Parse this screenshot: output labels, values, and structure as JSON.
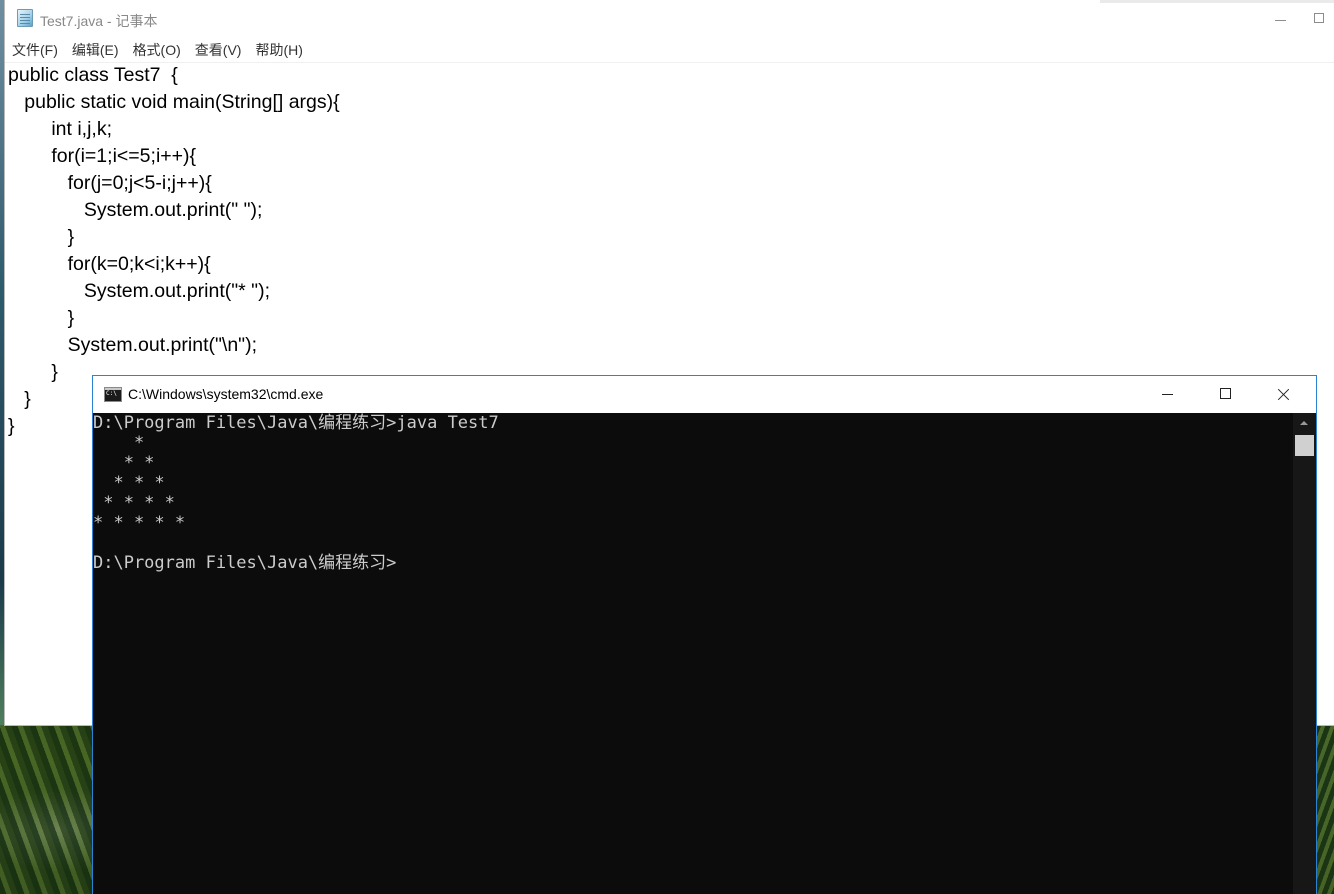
{
  "notepad": {
    "title": "Test7.java - 记事本",
    "menu": [
      "文件(F)",
      "编辑(E)",
      "格式(O)",
      "查看(V)",
      "帮助(H)"
    ],
    "code_lines": [
      "public class Test7  {",
      "   public static void main(String[] args){",
      "        int i,j,k;",
      "        for(i=1;i<=5;i++){",
      "           for(j=0;j<5-i;j++){",
      "              System.out.print(\" \");",
      "           }",
      "           for(k=0;k<i;k++){",
      "              System.out.print(\"* \");",
      "           }",
      "           System.out.print(\"\\n\");",
      "        }",
      "   }",
      "}"
    ]
  },
  "cmd": {
    "title": "C:\\Windows\\system32\\cmd.exe",
    "console_lines": [
      "D:\\Program Files\\Java\\编程练习>java Test7",
      "    *",
      "   * *",
      "  * * *",
      " * * * *",
      "* * * * *",
      "",
      "D:\\Program Files\\Java\\编程练习>"
    ]
  },
  "icons": {
    "notepad_app": "notepad-icon",
    "cmd_app": "cmd-icon",
    "minimize": "minimize-icon",
    "maximize": "maximize-icon",
    "close": "close-icon"
  }
}
